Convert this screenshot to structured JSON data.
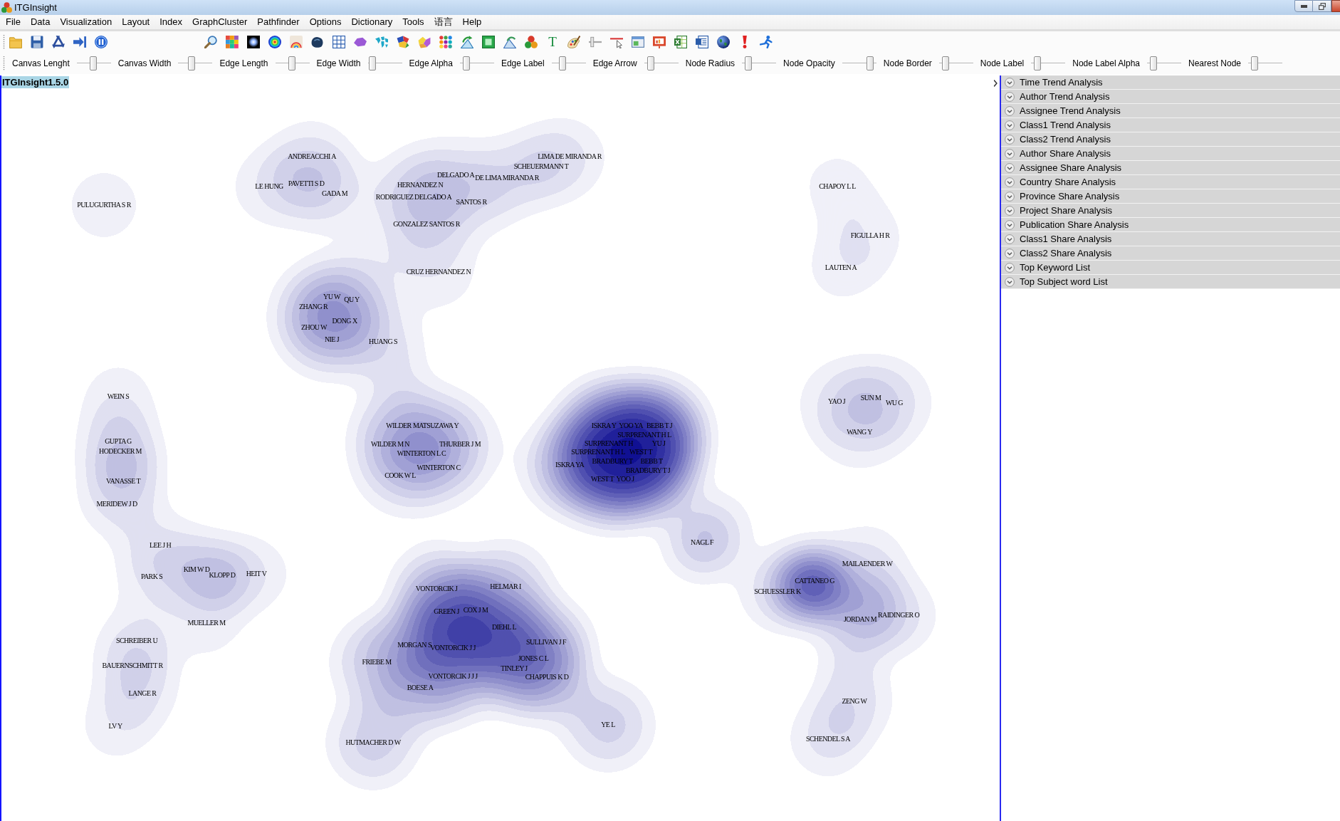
{
  "window": {
    "title": "ITGInsight"
  },
  "menu": [
    "File",
    "Data",
    "Visualization",
    "Layout",
    "Index",
    "GraphCluster",
    "Pathfinder",
    "Options",
    "Dictionary",
    "Tools",
    "语言",
    "Help"
  ],
  "toolbar": {
    "text_button": "T"
  },
  "sliders": [
    {
      "label": "Canvas Lenght",
      "level": 0.47
    },
    {
      "label": "Canvas Width",
      "level": 0.35
    },
    {
      "label": "Edge Length",
      "level": 0.49
    },
    {
      "label": "Edge Width",
      "level": 0.05
    },
    {
      "label": "Edge Alpha",
      "level": 0.1
    },
    {
      "label": "Edge Label",
      "level": 0.28
    },
    {
      "label": "Edge Arrow",
      "level": 0.1
    },
    {
      "label": "Node Radius",
      "level": 0.1
    },
    {
      "label": "Node Opacity",
      "level": 0.9
    },
    {
      "label": "Node Border",
      "level": 0.1
    },
    {
      "label": "Node Label",
      "level": 0.1
    },
    {
      "label": "Node Label Alpha",
      "level": 0.1
    },
    {
      "label": "Nearest Node",
      "level": 0.1
    }
  ],
  "canvas": {
    "version": "ITGInsight1.5.0",
    "clusters": [
      {
        "labels": [
          "PULUGURTHA S R"
        ]
      },
      {
        "labels": [
          "ANDREACCHI A",
          "LE HUNG",
          "PAVETTI S D",
          "GADA M",
          "HERNANDEZ N",
          "DELGADO A",
          "RODRIGUEZ DELGADO A",
          "SANTOS R",
          "GONZALEZ SANTOS R",
          "DE LIMA MIRANDA R",
          "SCHEUERMANN T",
          "LIMA DE MIRANDA R",
          "CRUZ HERNANDEZ N"
        ]
      },
      {
        "labels": [
          "CHAPOY L L",
          "FIGULLA H R",
          "LAUTEN A"
        ]
      },
      {
        "labels": [
          "YU W",
          "QU Y",
          "ZHANG R",
          "DONG X",
          "ZHOU W",
          "NIE J",
          "HUANG S"
        ]
      },
      {
        "labels": [
          "WEIN S",
          "GUPTA G",
          "HODECKER M",
          "VANASSE T",
          "MERIDEW J D",
          "LEE J H",
          "KIM W D",
          "KLOPP D",
          "HEIT V",
          "PARK S",
          "MUELLER M",
          "SCHREIBER U",
          "BAUERNSCHMITT R",
          "LANGE R",
          "LV Y"
        ]
      },
      {
        "labels": [
          "WILDER",
          "MATSUZAWA Y",
          "WILDER M N",
          "WINTERTON L C",
          "THURBER J M",
          "WINTERTON C",
          "COOK W L"
        ]
      },
      {
        "labels": [
          "ISKRA Y",
          "YOO YA",
          "BEBB T J",
          "SURPRENANT H L",
          "SURPRENANT H",
          "YU J",
          "SURPRENANT H L",
          "WEST T",
          "BRADBURY T",
          "BEBB T",
          "ISKRA YA",
          "BRADBURY T J",
          "WEST T",
          "YOO J"
        ]
      },
      {
        "labels": [
          "YAO J",
          "SUN M",
          "WU G",
          "WANG Y"
        ]
      },
      {
        "labels": [
          "VONTORCIK J",
          "HELMAR I",
          "GREEN J",
          "COX J M",
          "DIEHL L",
          "SULLIVAN J F",
          "MORGAN S",
          "VONTORCIK J J",
          "JONES C L",
          "FRIEBE M",
          "TINLEY J",
          "CHAPPUIS K D",
          "VONTORCIK J J J",
          "BOESE A",
          "YE L",
          "HUTMACHER D W"
        ]
      },
      {
        "labels": [
          "NAGL F",
          "MAILAENDER W",
          "CATTANEO G",
          "SCHUESSLER K",
          "JORDAN M",
          "RAIDINGER O",
          "ZENG W",
          "SCHENDEL S A"
        ]
      }
    ]
  },
  "panel": {
    "sections": [
      "Time Trend Analysis",
      "Author Trend Analysis",
      "Assignee Trend Analysis",
      "Class1 Trend Analysis",
      "Class2 Trend Analysis",
      "Author Share Analysis",
      "Assignee Share Analysis",
      "Country Share Analysis",
      "Province Share Analysis",
      "Project Share Analysis",
      "Publication Share Analysis",
      "Class1 Share Analysis",
      "Class2 Share Analysis",
      "Top Keyword List",
      "Top Subject word List"
    ]
  }
}
